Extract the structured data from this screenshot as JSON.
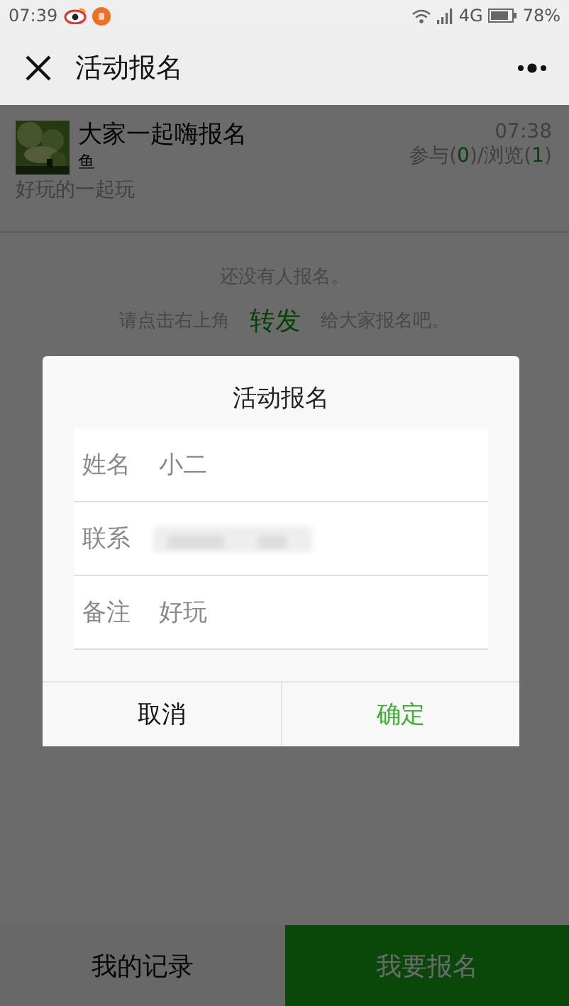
{
  "status_bar": {
    "time": "07:39",
    "network": "4G",
    "battery": "78%"
  },
  "header": {
    "title": "活动报名"
  },
  "event": {
    "kind": "picture",
    "title": "大家一起嗨报名",
    "organizer": "鱼",
    "time": "07:38",
    "stats": [
      {
        "label": "参与(",
        "count": "0",
        "sep": ")/"
      },
      {
        "label": "浏览(",
        "count": "1",
        "sep": ")"
      }
    ],
    "description": "好玩的一起玩"
  },
  "empty": {
    "line1": "还没有人报名。",
    "line2_before": "请点击右上角",
    "line2_link": "转发",
    "line2_after": "给大家报名吧。"
  },
  "dialog": {
    "title": "活动报名",
    "fields": [
      {
        "label": "姓名",
        "value": "小二",
        "redacted": false
      },
      {
        "label": "联系",
        "redacted": true
      },
      {
        "label": "备注",
        "value": "好玩",
        "redacted": false
      }
    ],
    "buttons": [
      {
        "label": "取消",
        "primary": false
      },
      {
        "label": "确定",
        "primary": true
      }
    ]
  },
  "bottom_bar": [
    {
      "label": "我的记录",
      "primary": false
    },
    {
      "label": "我要报名",
      "primary": true
    }
  ]
}
